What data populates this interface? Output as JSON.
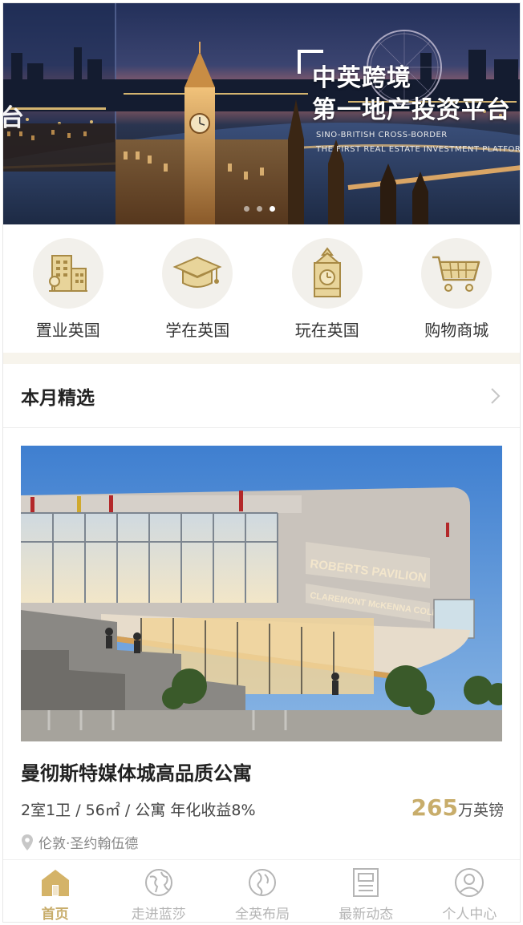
{
  "banner": {
    "title_line1": "中英跨境",
    "title_line2": "第一地产投资平台",
    "subtitle_line1": "SINO-BRITISH CROSS-BORDER",
    "subtitle_line2": "THE FIRST REAL ESTATE INVESTMENT PLATFORM",
    "left_fragment": "台",
    "slides_count": 3,
    "active_slide": 3
  },
  "categories": [
    {
      "label": "置业英国",
      "icon": "building-icon"
    },
    {
      "label": "学在英国",
      "icon": "graduation-cap-icon"
    },
    {
      "label": "玩在英国",
      "icon": "big-ben-icon"
    },
    {
      "label": "购物商城",
      "icon": "shopping-cart-icon"
    }
  ],
  "section": {
    "title": "本月精选"
  },
  "listing": {
    "image_signs": [
      "ROBERTS PAVILION",
      "CLAREMONT McKENNA COLLEGE"
    ],
    "title": "曼彻斯特媒体城高品质公寓",
    "spec": "2室1卫 / 56㎡ / 公寓 年化收益8%",
    "price_value": "265",
    "price_unit": "万英镑",
    "location": "伦敦·圣约翰伍德"
  },
  "tabbar": [
    {
      "label": "首页",
      "icon": "home-icon",
      "active": true
    },
    {
      "label": "走进蓝莎",
      "icon": "globe-icon",
      "active": false
    },
    {
      "label": "全英布局",
      "icon": "map-icon",
      "active": false
    },
    {
      "label": "最新动态",
      "icon": "news-icon",
      "active": false
    },
    {
      "label": "个人中心",
      "icon": "user-icon",
      "active": false
    }
  ],
  "colors": {
    "accent_gold": "#c8ad6b",
    "icon_circle_bg": "#f2f0eb",
    "divider_band": "#f7f4ec"
  }
}
